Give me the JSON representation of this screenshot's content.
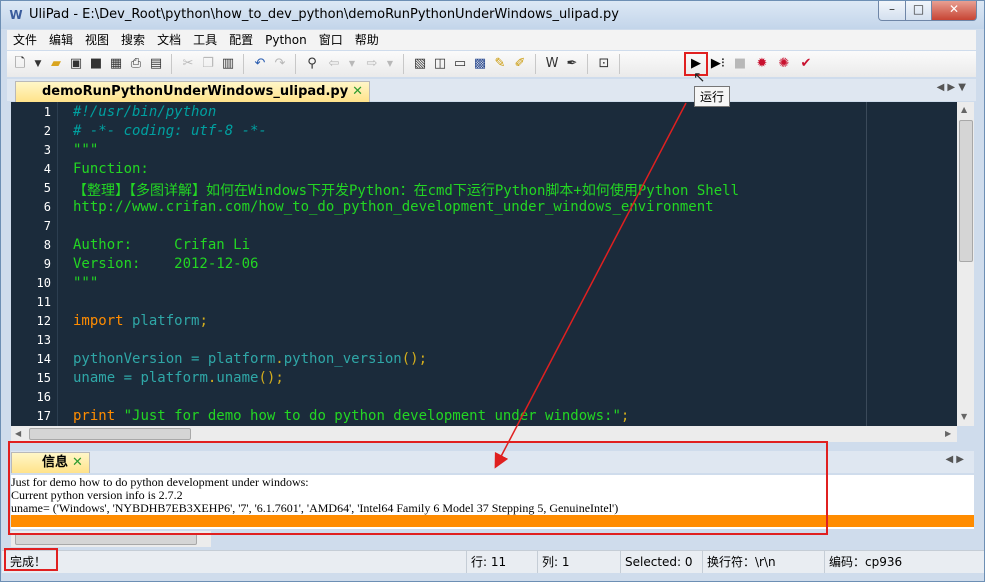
{
  "window": {
    "title": "UliPad - E:\\Dev_Root\\python\\how_to_dev_python\\demoRunPythonUnderWindows_ulipad.py",
    "controls": {
      "minimize": "–",
      "maximize": "□",
      "close": "✕"
    }
  },
  "menu": [
    "文件",
    "编辑",
    "视图",
    "搜索",
    "文档",
    "工具",
    "配置",
    "Python",
    "窗口",
    "帮助"
  ],
  "toolbar": {
    "run_tooltip": "运行",
    "icons": [
      "new-file-icon",
      "dropdown-arrow-icon",
      "open-folder-icon",
      "open-icon",
      "save-icon",
      "save-all-icon",
      "print-icon",
      "preview-icon",
      "cut-icon",
      "copy-icon",
      "paste-icon",
      "undo-icon",
      "redo-icon",
      "find-icon",
      "back-icon",
      "forward-icon",
      "properties-icon",
      "layout-icon",
      "layout-icon",
      "python-shell-icon",
      "snippets-icon",
      "tags-icon",
      "wrap-icon",
      "pen-icon",
      "search-window-icon",
      "run-icon",
      "run-args-icon",
      "stop-icon",
      "debug-icon",
      "debug-stop-icon",
      "check-icon"
    ]
  },
  "editor": {
    "tab_label": "demoRunPythonUnderWindows_ulipad.py",
    "tab_close": "✕",
    "line_numbers": [
      "1",
      "2",
      "3",
      "4",
      "5",
      "6",
      "7",
      "8",
      "9",
      "10",
      "11",
      "12",
      "13",
      "14",
      "15",
      "16",
      "17"
    ],
    "lines": {
      "l1": "#!/usr/bin/python",
      "l2": "# -*- coding: utf-8 -*-",
      "l3": "\"\"\"",
      "l4": "Function:",
      "l5": "【整理】【多图详解】如何在Windows下开发Python：在cmd下运行Python脚本+如何使用Python Shell",
      "l6": "http://www.crifan.com/how_to_do_python_development_under_windows_environment",
      "l8": "Author:     Crifan Li",
      "l9": "Version:    2012-12-06",
      "l10": "\"\"\"",
      "l12_kw": "import",
      "l12_id": " platform",
      "l12_p": ";",
      "l14_a": "pythonVersion",
      "l14_b": " = platform",
      "l14_c": ".",
      "l14_d": "python_version",
      "l14_e": "();",
      "l15_a": "uname",
      "l15_b": " = platform",
      "l15_c": ".",
      "l15_d": "uname",
      "l15_e": "();",
      "l17_kw": "print",
      "l17_str": " \"Just for demo how to do python development under windows:\"",
      "l17_p": ";"
    }
  },
  "info_panel": {
    "tab_label": "信息",
    "tab_close": "✕",
    "output": [
      "Just for demo how to do python development under windows:",
      "Current python version info is 2.7.2",
      "uname= ('Windows', 'NYBDHB7EB3XEHP6', '7', '6.1.7601', 'AMD64', 'Intel64 Family 6 Model 37 Stepping 5, GenuineIntel')"
    ]
  },
  "status": {
    "message": "完成！",
    "line": "行: 11",
    "col": "列: 1",
    "selected": "Selected: 0",
    "eol": "换行符：\\r\\n",
    "encoding": "编码：cp936"
  },
  "colors": {
    "annotation": "#e02020",
    "editor_bg": "#1b2b3b",
    "output_bar": "#ff8c00"
  }
}
